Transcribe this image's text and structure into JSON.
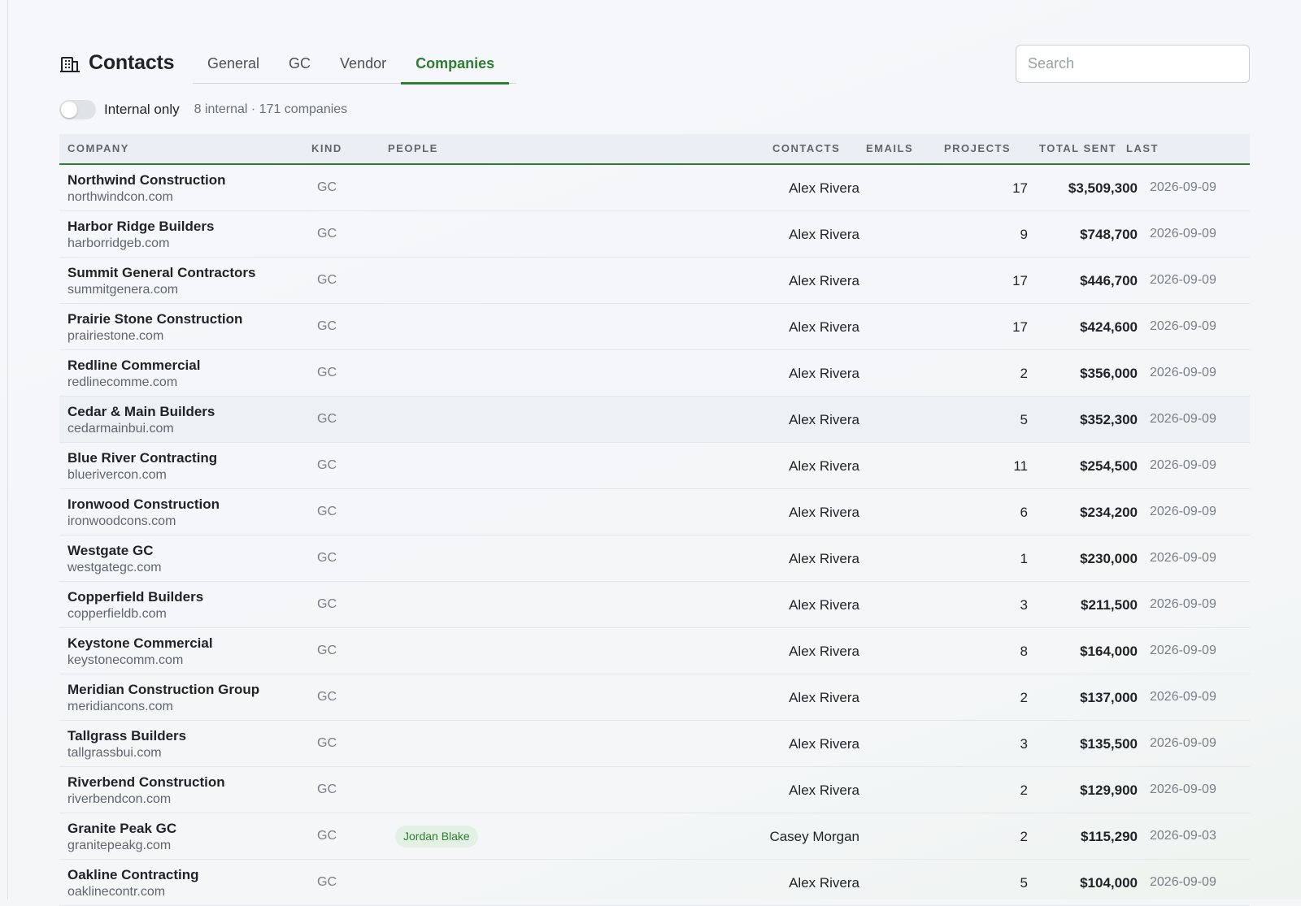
{
  "header": {
    "title": "Contacts",
    "title_icon": "building-icon",
    "tabs": [
      {
        "label": "General",
        "active": false
      },
      {
        "label": "GC",
        "active": false
      },
      {
        "label": "Vendor",
        "active": false
      },
      {
        "label": "Companies",
        "active": true
      }
    ],
    "search_placeholder": "Search"
  },
  "filter": {
    "toggle_label": "Internal only",
    "toggle_on": false,
    "stats": "8 internal · 171 companies"
  },
  "colors": {
    "accent": "#2e7d32",
    "header_bg": "#ebeff4",
    "pill_bg": "#e3f1e4"
  },
  "table": {
    "columns": {
      "company": "COMPANY",
      "kind": "KIND",
      "people": "PEOPLE",
      "contacts": "CONTACTS",
      "emails": "EMAILS",
      "projects": "PROJECTS",
      "total_sent": "TOTAL SENT",
      "last": "LAST"
    },
    "rows": [
      {
        "name": "Northwind Construction",
        "domain": "northwindcon.com",
        "kind": "GC",
        "people": "",
        "contacts": "Alex Rivera",
        "emails": "",
        "projects": "17",
        "total_sent": "$3,509,300",
        "last": "2026-09-09"
      },
      {
        "name": "Harbor Ridge Builders",
        "domain": "harborridgeb.com",
        "kind": "GC",
        "people": "",
        "contacts": "Alex Rivera",
        "emails": "",
        "projects": "9",
        "total_sent": "$748,700",
        "last": "2026-09-09"
      },
      {
        "name": "Summit General Contractors",
        "domain": "summitgenera.com",
        "kind": "GC",
        "people": "",
        "contacts": "Alex Rivera",
        "emails": "",
        "projects": "17",
        "total_sent": "$446,700",
        "last": "2026-09-09"
      },
      {
        "name": "Prairie Stone Construction",
        "domain": "prairiestone.com",
        "kind": "GC",
        "people": "",
        "contacts": "Alex Rivera",
        "emails": "",
        "projects": "17",
        "total_sent": "$424,600",
        "last": "2026-09-09"
      },
      {
        "name": "Redline Commercial",
        "domain": "redlinecomme.com",
        "kind": "GC",
        "people": "",
        "contacts": "Alex Rivera",
        "emails": "",
        "projects": "2",
        "total_sent": "$356,000",
        "last": "2026-09-09"
      },
      {
        "name": "Cedar & Main Builders",
        "domain": "cedarmainbui.com",
        "kind": "GC",
        "people": "",
        "contacts": "Alex Rivera",
        "emails": "",
        "projects": "5",
        "total_sent": "$352,300",
        "last": "2026-09-09",
        "hover": true
      },
      {
        "name": "Blue River Contracting",
        "domain": "bluerivercon.com",
        "kind": "GC",
        "people": "",
        "contacts": "Alex Rivera",
        "emails": "",
        "projects": "11",
        "total_sent": "$254,500",
        "last": "2026-09-09"
      },
      {
        "name": "Ironwood Construction",
        "domain": "ironwoodcons.com",
        "kind": "GC",
        "people": "",
        "contacts": "Alex Rivera",
        "emails": "",
        "projects": "6",
        "total_sent": "$234,200",
        "last": "2026-09-09"
      },
      {
        "name": "Westgate GC",
        "domain": "westgategc.com",
        "kind": "GC",
        "people": "",
        "contacts": "Alex Rivera",
        "emails": "",
        "projects": "1",
        "total_sent": "$230,000",
        "last": "2026-09-09"
      },
      {
        "name": "Copperfield Builders",
        "domain": "copperfieldb.com",
        "kind": "GC",
        "people": "",
        "contacts": "Alex Rivera",
        "emails": "",
        "projects": "3",
        "total_sent": "$211,500",
        "last": "2026-09-09"
      },
      {
        "name": "Keystone Commercial",
        "domain": "keystonecomm.com",
        "kind": "GC",
        "people": "",
        "contacts": "Alex Rivera",
        "emails": "",
        "projects": "8",
        "total_sent": "$164,000",
        "last": "2026-09-09"
      },
      {
        "name": "Meridian Construction Group",
        "domain": "meridiancons.com",
        "kind": "GC",
        "people": "",
        "contacts": "Alex Rivera",
        "emails": "",
        "projects": "2",
        "total_sent": "$137,000",
        "last": "2026-09-09"
      },
      {
        "name": "Tallgrass Builders",
        "domain": "tallgrassbui.com",
        "kind": "GC",
        "people": "",
        "contacts": "Alex Rivera",
        "emails": "",
        "projects": "3",
        "total_sent": "$135,500",
        "last": "2026-09-09"
      },
      {
        "name": "Riverbend Construction",
        "domain": "riverbendcon.com",
        "kind": "GC",
        "people": "",
        "contacts": "Alex Rivera",
        "emails": "",
        "projects": "2",
        "total_sent": "$129,900",
        "last": "2026-09-09"
      },
      {
        "name": "Granite Peak GC",
        "domain": "granitepeakg.com",
        "kind": "GC",
        "people": "Jordan Blake",
        "contacts": "Casey Morgan",
        "emails": "",
        "projects": "2",
        "total_sent": "$115,290",
        "last": "2026-09-03"
      },
      {
        "name": "Oakline Contracting",
        "domain": "oaklinecontr.com",
        "kind": "GC",
        "people": "",
        "contacts": "Alex Rivera",
        "emails": "",
        "projects": "5",
        "total_sent": "$104,000",
        "last": "2026-09-09"
      }
    ]
  }
}
